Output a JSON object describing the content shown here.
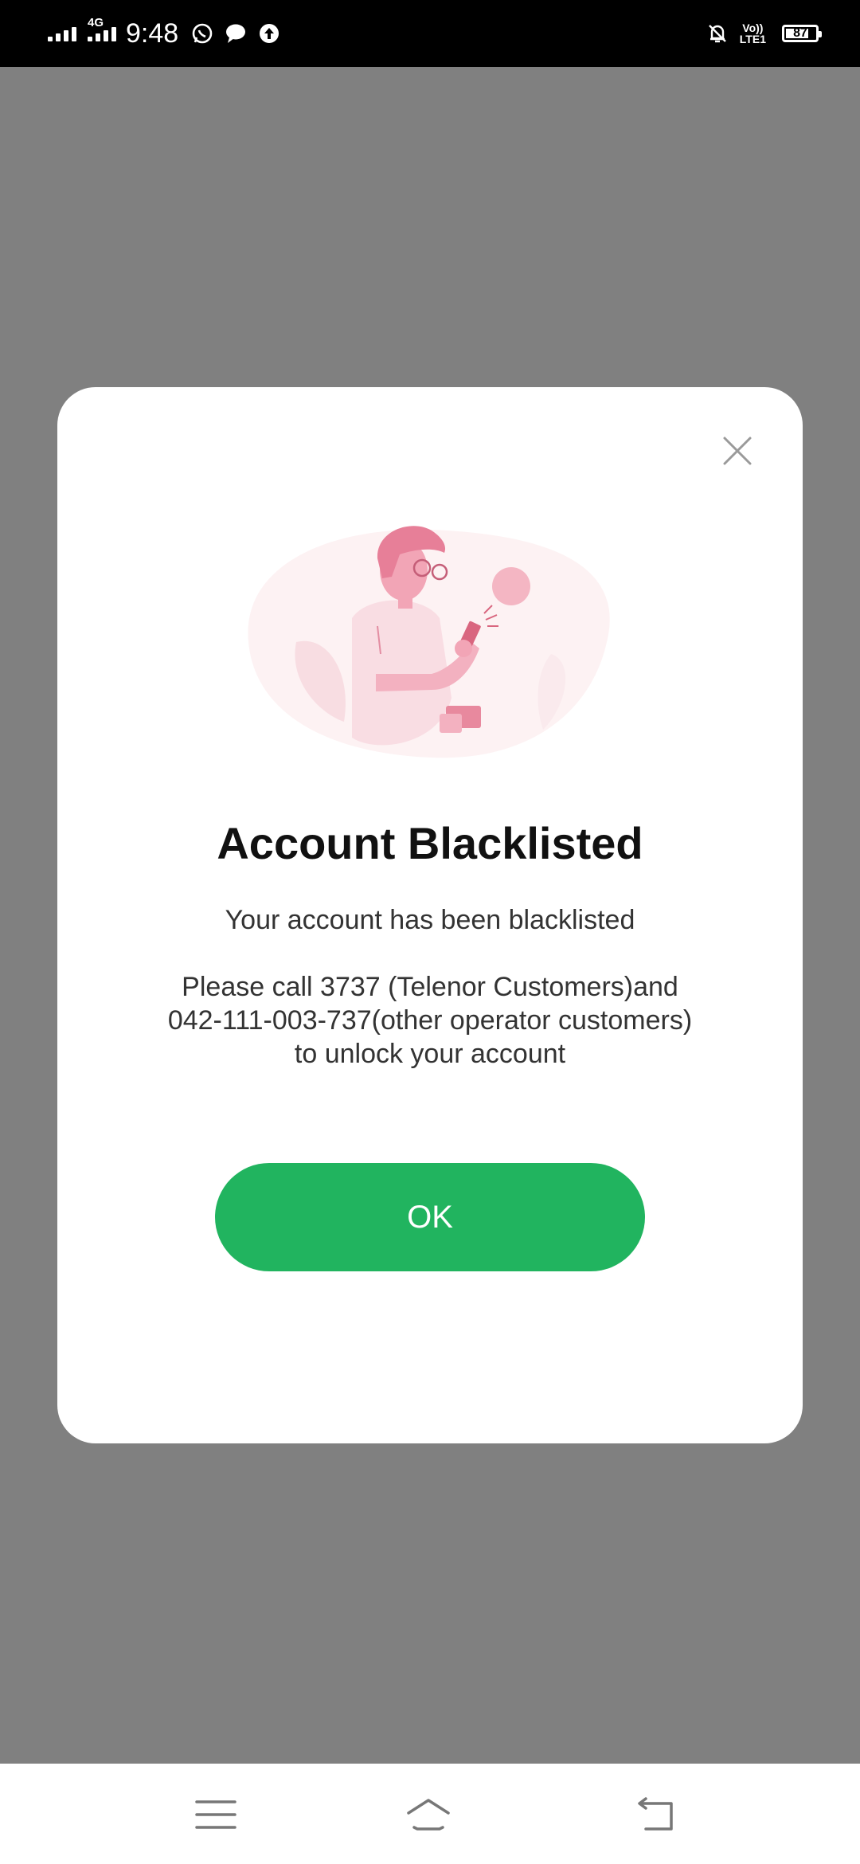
{
  "status_bar": {
    "time": "9:48",
    "network": "4G",
    "volte_line1": "Vo))",
    "volte_line2": "LTE1",
    "battery": "87",
    "icons": [
      "signal-icon",
      "whatsapp-icon",
      "message-icon",
      "upload-icon",
      "bell-muted-icon",
      "battery-icon"
    ]
  },
  "dialog": {
    "title": "Account Blacklisted",
    "message": "Your account has been blacklisted",
    "instructions": {
      "line1": "Please call 3737 (Telenor Customers)and",
      "line2": "042-111-003-737(other operator customers)",
      "line3": "to unlock your account"
    },
    "ok_label": "OK",
    "accent_color": "#21b45f",
    "illustration_icon": "person-with-phone-illustration"
  },
  "nav_bar": {
    "icons": [
      "menu-icon",
      "home-icon",
      "back-icon"
    ]
  }
}
